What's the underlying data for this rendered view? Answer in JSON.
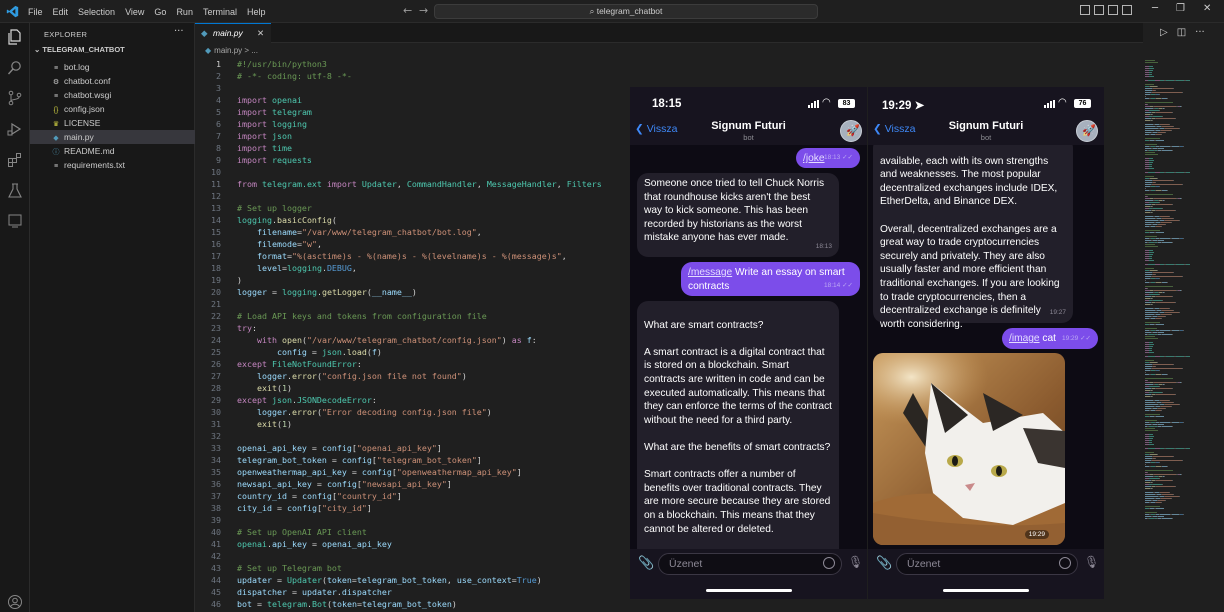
{
  "menu": [
    "File",
    "Edit",
    "Selection",
    "View",
    "Go",
    "Run",
    "Terminal",
    "Help"
  ],
  "search": {
    "text": "telegram_chatbot"
  },
  "sidebar": {
    "header": "EXPLORER",
    "more": "···",
    "project": "TELEGRAM_CHATBOT",
    "files": [
      {
        "name": "bot.log",
        "icon": "log-icon",
        "glyph": "≡",
        "color": "#cccccc"
      },
      {
        "name": "chatbot.conf",
        "icon": "gear-icon",
        "glyph": "⚙",
        "color": "#cccccc"
      },
      {
        "name": "chatbot.wsgi",
        "icon": "file-icon",
        "glyph": "≡",
        "color": "#cccccc"
      },
      {
        "name": "config.json",
        "icon": "json-icon",
        "glyph": "{}",
        "color": "#cbcb41"
      },
      {
        "name": "LICENSE",
        "icon": "license-icon",
        "glyph": "♛",
        "color": "#cbcb41"
      },
      {
        "name": "main.py",
        "icon": "python-icon",
        "glyph": "◆",
        "color": "#519aba"
      },
      {
        "name": "README.md",
        "icon": "info-icon",
        "glyph": "ⓘ",
        "color": "#519aba"
      },
      {
        "name": "requirements.txt",
        "icon": "text-file-icon",
        "glyph": "≡",
        "color": "#cccccc"
      }
    ]
  },
  "editor": {
    "tab_label": "main.py",
    "breadcrumb": "main.py > ...",
    "active_line": 1,
    "lines": [
      [
        [
          "cm",
          "#!/usr/bin/python3"
        ]
      ],
      [
        [
          "cm",
          "# -*- coding: utf-8 -*-"
        ]
      ],
      [],
      [
        [
          "kw",
          "import "
        ],
        [
          "cl",
          "openai"
        ]
      ],
      [
        [
          "kw",
          "import "
        ],
        [
          "cl",
          "telegram"
        ]
      ],
      [
        [
          "kw",
          "import "
        ],
        [
          "cl",
          "logging"
        ]
      ],
      [
        [
          "kw",
          "import "
        ],
        [
          "cl",
          "json"
        ]
      ],
      [
        [
          "kw",
          "import "
        ],
        [
          "cl",
          "time"
        ]
      ],
      [
        [
          "kw",
          "import "
        ],
        [
          "cl",
          "requests"
        ]
      ],
      [],
      [
        [
          "kw",
          "from "
        ],
        [
          "cl",
          "telegram.ext"
        ],
        [
          "kw",
          " import "
        ],
        [
          "cl",
          "Updater"
        ],
        [
          "df",
          ", "
        ],
        [
          "cl",
          "CommandHandler"
        ],
        [
          "df",
          ", "
        ],
        [
          "cl",
          "MessageHandler"
        ],
        [
          "df",
          ", "
        ],
        [
          "cl",
          "Filters"
        ]
      ],
      [],
      [
        [
          "cm",
          "# Set up logger"
        ]
      ],
      [
        [
          "cl",
          "logging"
        ],
        [
          "df",
          "."
        ],
        [
          "fn",
          "basicConfig"
        ],
        [
          "df",
          "("
        ]
      ],
      [
        [
          "vr",
          "    filename"
        ],
        [
          "df",
          "="
        ],
        [
          "st",
          "\"/var/www/telegram_chatbot/bot.log\""
        ],
        [
          "df",
          ","
        ]
      ],
      [
        [
          "vr",
          "    filemode"
        ],
        [
          "df",
          "="
        ],
        [
          "st",
          "\"w\""
        ],
        [
          "df",
          ","
        ]
      ],
      [
        [
          "vr",
          "    format"
        ],
        [
          "df",
          "="
        ],
        [
          "st",
          "\"%(asctime)s - %(name)s - %(levelname)s - %(message)s\""
        ],
        [
          "df",
          ","
        ]
      ],
      [
        [
          "vr",
          "    level"
        ],
        [
          "df",
          "="
        ],
        [
          "cl",
          "logging"
        ],
        [
          "df",
          "."
        ],
        [
          "kb",
          "DEBUG"
        ],
        [
          "df",
          ","
        ]
      ],
      [
        [
          "df",
          ")"
        ]
      ],
      [
        [
          "vr",
          "logger"
        ],
        [
          "df",
          " = "
        ],
        [
          "cl",
          "logging"
        ],
        [
          "df",
          "."
        ],
        [
          "fn",
          "getLogger"
        ],
        [
          "df",
          "("
        ],
        [
          "vr",
          "__name__"
        ],
        [
          "df",
          ")"
        ]
      ],
      [],
      [
        [
          "cm",
          "# Load API keys and tokens from configuration file"
        ]
      ],
      [
        [
          "kw",
          "try"
        ],
        [
          "df",
          ":"
        ]
      ],
      [
        [
          "kw",
          "    with "
        ],
        [
          "fn",
          "open"
        ],
        [
          "df",
          "("
        ],
        [
          "st",
          "\"/var/www/telegram_chatbot/config.json\""
        ],
        [
          "df",
          ") "
        ],
        [
          "kw",
          "as "
        ],
        [
          "vr",
          "f"
        ],
        [
          "df",
          ":"
        ]
      ],
      [
        [
          "vr",
          "        config"
        ],
        [
          "df",
          " = "
        ],
        [
          "cl",
          "json"
        ],
        [
          "df",
          "."
        ],
        [
          "fn",
          "load"
        ],
        [
          "df",
          "("
        ],
        [
          "vr",
          "f"
        ],
        [
          "df",
          ")"
        ]
      ],
      [
        [
          "kw",
          "except "
        ],
        [
          "cl",
          "FileNotFoundError"
        ],
        [
          "df",
          ":"
        ]
      ],
      [
        [
          "vr",
          "    logger"
        ],
        [
          "df",
          "."
        ],
        [
          "fn",
          "error"
        ],
        [
          "df",
          "("
        ],
        [
          "st",
          "\"config.json file not found\""
        ],
        [
          "df",
          ")"
        ]
      ],
      [
        [
          "fn",
          "    exit"
        ],
        [
          "df",
          "("
        ],
        [
          "nm",
          "1"
        ],
        [
          "df",
          ")"
        ]
      ],
      [
        [
          "kw",
          "except "
        ],
        [
          "cl",
          "json"
        ],
        [
          "df",
          "."
        ],
        [
          "cl",
          "JSONDecodeError"
        ],
        [
          "df",
          ":"
        ]
      ],
      [
        [
          "vr",
          "    logger"
        ],
        [
          "df",
          "."
        ],
        [
          "fn",
          "error"
        ],
        [
          "df",
          "("
        ],
        [
          "st",
          "\"Error decoding config.json file\""
        ],
        [
          "df",
          ")"
        ]
      ],
      [
        [
          "fn",
          "    exit"
        ],
        [
          "df",
          "("
        ],
        [
          "nm",
          "1"
        ],
        [
          "df",
          ")"
        ]
      ],
      [],
      [
        [
          "vr",
          "openai_api_key"
        ],
        [
          "df",
          " = "
        ],
        [
          "vr",
          "config"
        ],
        [
          "df",
          "["
        ],
        [
          "st",
          "\"openai_api_key\""
        ],
        [
          "df",
          "]"
        ]
      ],
      [
        [
          "vr",
          "telegram_bot_token"
        ],
        [
          "df",
          " = "
        ],
        [
          "vr",
          "config"
        ],
        [
          "df",
          "["
        ],
        [
          "st",
          "\"telegram_bot_token\""
        ],
        [
          "df",
          "]"
        ]
      ],
      [
        [
          "vr",
          "openweathermap_api_key"
        ],
        [
          "df",
          " = "
        ],
        [
          "vr",
          "config"
        ],
        [
          "df",
          "["
        ],
        [
          "st",
          "\"openweathermap_api_key\""
        ],
        [
          "df",
          "]"
        ]
      ],
      [
        [
          "vr",
          "newsapi_api_key"
        ],
        [
          "df",
          " = "
        ],
        [
          "vr",
          "config"
        ],
        [
          "df",
          "["
        ],
        [
          "st",
          "\"newsapi_api_key\""
        ],
        [
          "df",
          "]"
        ]
      ],
      [
        [
          "vr",
          "country_id"
        ],
        [
          "df",
          " = "
        ],
        [
          "vr",
          "config"
        ],
        [
          "df",
          "["
        ],
        [
          "st",
          "\"country_id\""
        ],
        [
          "df",
          "]"
        ]
      ],
      [
        [
          "vr",
          "city_id"
        ],
        [
          "df",
          " = "
        ],
        [
          "vr",
          "config"
        ],
        [
          "df",
          "["
        ],
        [
          "st",
          "\"city_id\""
        ],
        [
          "df",
          "]"
        ]
      ],
      [],
      [
        [
          "cm",
          "# Set up OpenAI API client"
        ]
      ],
      [
        [
          "cl",
          "openai"
        ],
        [
          "df",
          "."
        ],
        [
          "vr",
          "api_key"
        ],
        [
          "df",
          " = "
        ],
        [
          "vr",
          "openai_api_key"
        ]
      ],
      [],
      [
        [
          "cm",
          "# Set up Telegram bot"
        ]
      ],
      [
        [
          "vr",
          "updater"
        ],
        [
          "df",
          " = "
        ],
        [
          "cl",
          "Updater"
        ],
        [
          "df",
          "("
        ],
        [
          "vr",
          "token"
        ],
        [
          "df",
          "="
        ],
        [
          "vr",
          "telegram_bot_token"
        ],
        [
          "df",
          ", "
        ],
        [
          "vr",
          "use_context"
        ],
        [
          "df",
          "="
        ],
        [
          "kb",
          "True"
        ],
        [
          "df",
          ")"
        ]
      ],
      [
        [
          "vr",
          "dispatcher"
        ],
        [
          "df",
          " = "
        ],
        [
          "vr",
          "updater"
        ],
        [
          "df",
          "."
        ],
        [
          "vr",
          "dispatcher"
        ]
      ],
      [
        [
          "vr",
          "bot"
        ],
        [
          "df",
          " = "
        ],
        [
          "cl",
          "telegram"
        ],
        [
          "df",
          "."
        ],
        [
          "cl",
          "Bot"
        ],
        [
          "df",
          "("
        ],
        [
          "vr",
          "token"
        ],
        [
          "df",
          "="
        ],
        [
          "vr",
          "telegram_bot_token"
        ],
        [
          "df",
          ")"
        ]
      ]
    ]
  },
  "phone1": {
    "time": "18:15",
    "battery": "83",
    "back": "Vissza",
    "chat_name": "Signum Futuri",
    "chat_role": "bot",
    "input_placeholder": "Üzenet",
    "messages": [
      {
        "cmd": "/joke",
        "text": "",
        "time": "18:13"
      },
      {
        "text": "Someone once tried to tell Chuck Norris that roundhouse kicks aren't the best way to kick someone. This has been recorded by historians as the worst mistake anyone has ever made.",
        "time": "18:13"
      },
      {
        "cmd": "/message",
        "text": " Write an essay on smart contracts",
        "time": "18:14"
      },
      {
        "text": "What are smart contracts?\n\nA smart contract is a digital contract that is stored on a blockchain. Smart contracts are written in code and can be executed automatically. This means that they can enforce the terms of the contract without the need for a third party.\n\nWhat are the benefits of smart contracts?\n\nSmart contracts offer a number of benefits over traditional contracts. They are more secure because they are stored on a blockchain. This means that they cannot be altered or deleted."
      }
    ]
  },
  "phone2": {
    "time": "19:29",
    "battery": "76",
    "back": "Vissza",
    "chat_name": "Signum Futuri",
    "chat_role": "bot",
    "input_placeholder": "Üzenet",
    "messages": [
      {
        "text": "available, each with its own strengths and weaknesses. The most popular decentralized exchanges include IDEX, EtherDelta, and Binance DEX.\n\nOverall, decentralized exchanges are a great way to trade cryptocurrencies securely and privately. They are also usually faster and more efficient than traditional exchanges. If you are looking to trade cryptocurrencies, then a decentralized exchange is definitely worth considering.",
        "time": "19:27"
      },
      {
        "cmd": "/image",
        "text": " cat",
        "time": "19:29"
      },
      {
        "photo_time": "19:29"
      }
    ]
  },
  "colors": {
    "accent": "#0078d4",
    "telegram_outgoing": "#7c4dea",
    "telegram_incoming": "#221f2a"
  }
}
